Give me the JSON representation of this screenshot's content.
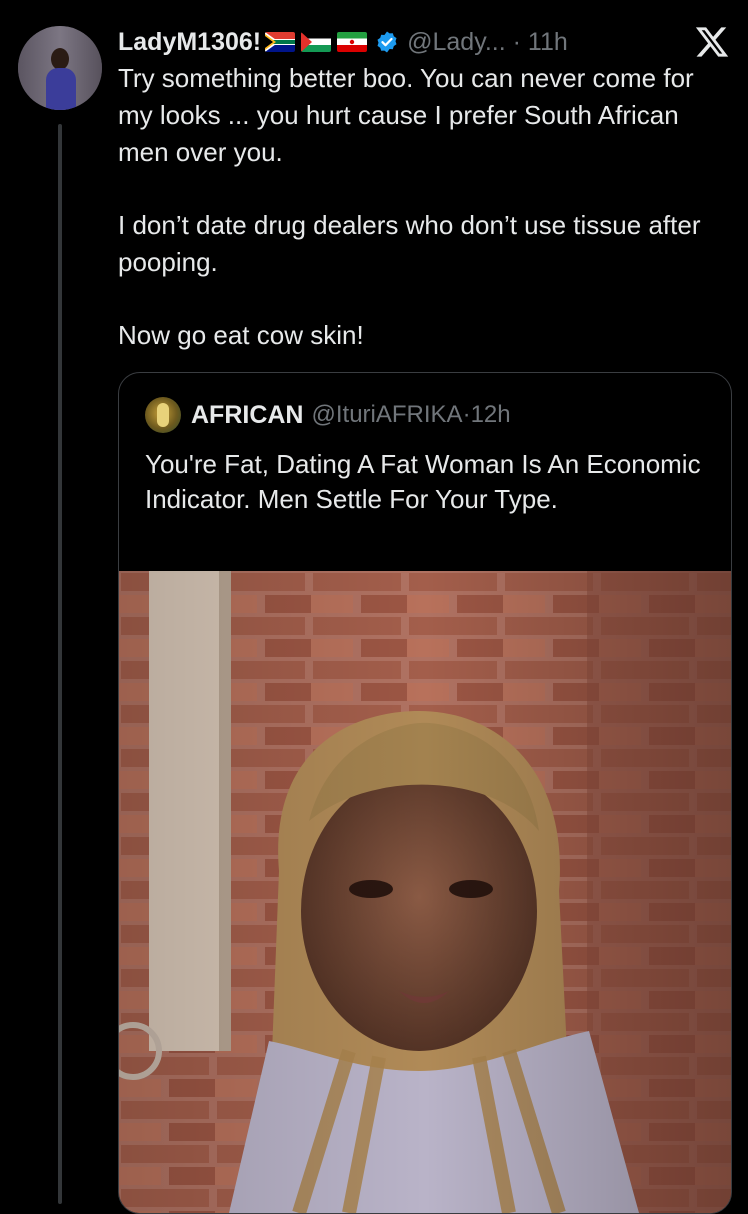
{
  "tweet": {
    "display_name": "LadyM1306!",
    "flags": [
      "south-africa-flag",
      "palestine-flag",
      "iran-flag"
    ],
    "handle": "@Lady...",
    "time": "11h",
    "paragraphs": [
      "Try something better boo. You can never come for my looks ... you hurt cause I prefer South African men over you.",
      "I don’t date drug dealers who don’t use tissue after pooping.",
      "Now go eat cow skin!"
    ]
  },
  "quote": {
    "display_name": "AFRICAN",
    "handle": "@IturiAFRIKA",
    "time": "12h",
    "text": "You're Fat, Dating A Fat Woman Is An Economic Indicator. Men Settle For Your Type."
  },
  "icons": {
    "brand": "x-logo-icon",
    "verified": "verified-badge-icon"
  },
  "colors": {
    "background": "#000000",
    "text": "#e7e9ea",
    "muted": "#71767b",
    "verified": "#1d9bf0",
    "border": "#3a3d41"
  }
}
